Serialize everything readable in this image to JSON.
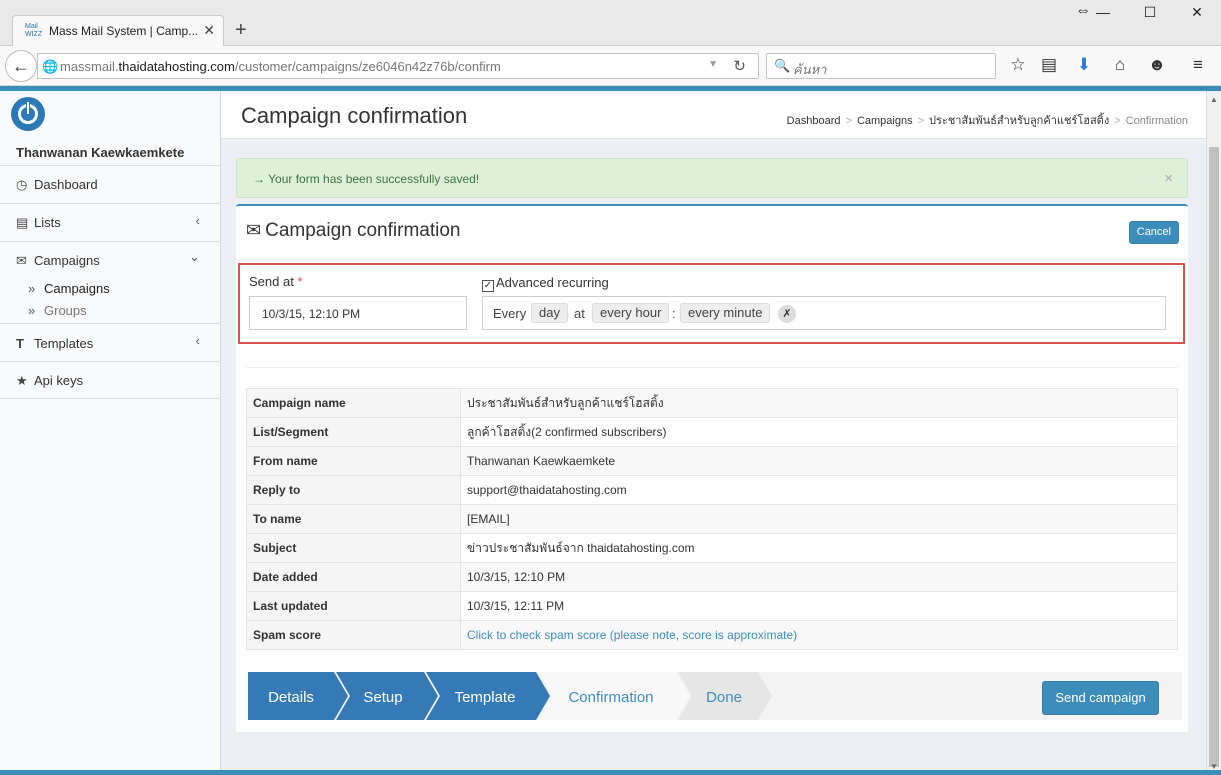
{
  "browser": {
    "tab_title": "Mass Mail System | Camp...",
    "favicon_text": "Mail\nWIZZ",
    "url_prefix": "massmail.",
    "url_domain": "thaidatahosting.com",
    "url_path": "/customer/campaigns/ze6046n42z76b/confirm",
    "search_placeholder": "ค้นหา",
    "new_tab": "+"
  },
  "sidebar": {
    "username": "Thanwanan Kaewkaemkete",
    "items": [
      {
        "label": "Dashboard",
        "icon": "dashboard-icon"
      },
      {
        "label": "Lists",
        "icon": "list-icon"
      },
      {
        "label": "Campaigns",
        "icon": "envelope-icon"
      },
      {
        "label": "Templates",
        "icon": "text-icon"
      },
      {
        "label": "Api keys",
        "icon": "star-icon"
      }
    ],
    "campaign_sub": [
      "Campaigns",
      "Groups"
    ]
  },
  "header": {
    "title": "Campaign confirmation",
    "breadcrumb": [
      "Dashboard",
      "Campaigns",
      "ประชาสัมพันธ์สำหรับลูกค้าแชร์โฮสติ้ง",
      "Confirmation"
    ]
  },
  "alert": {
    "message": "→ Your form has been successfully saved!",
    "close": "×"
  },
  "box": {
    "title": "Campaign confirmation",
    "cancel_label": "Cancel",
    "send_at_label": "Send at",
    "required_mark": "*",
    "send_at_value": "10/3/15, 12:10 PM",
    "advanced_label": "Advanced recurring",
    "cron": {
      "every": "Every",
      "period": "day",
      "at": "at",
      "hour": "every hour",
      "colon": ":",
      "minute": "every minute",
      "clear": "✗"
    }
  },
  "details": [
    {
      "key": "Campaign name",
      "value": "ประชาสัมพันธ์สำหรับลูกค้าแชร์โฮสติ้ง"
    },
    {
      "key": "List/Segment",
      "value": "ลูกค้าโฮสติ้ง(2 confirmed subscribers)"
    },
    {
      "key": "From name",
      "value": "Thanwanan Kaewkaemkete"
    },
    {
      "key": "Reply to",
      "value": "support@thaidatahosting.com"
    },
    {
      "key": "To name",
      "value": "[EMAIL]"
    },
    {
      "key": "Subject",
      "value": "ข่าวประชาสัมพันธ์จาก thaidatahosting.com"
    },
    {
      "key": "Date added",
      "value": "10/3/15, 12:10 PM"
    },
    {
      "key": "Last updated",
      "value": "10/3/15, 12:11 PM"
    },
    {
      "key": "Spam score",
      "value": "Click to check spam score (please note, score is approximate)"
    }
  ],
  "wizard": {
    "steps": [
      "Details",
      "Setup",
      "Template",
      "Confirmation",
      "Done"
    ],
    "send_label": "Send campaign"
  },
  "colors": {
    "accent": "#3c8dbc",
    "alert_bg": "#dff0d8",
    "highlight_border": "#d9534f"
  }
}
